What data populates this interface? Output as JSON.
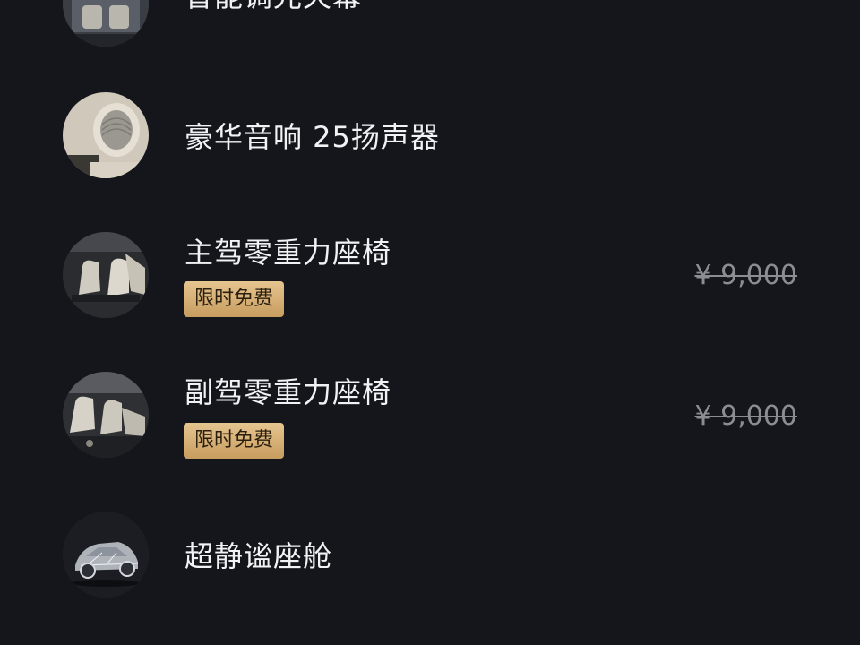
{
  "features": [
    {
      "title": "智能调光天幕",
      "thumb_icon": "interior-cabin-icon"
    },
    {
      "title": "豪华音响 25扬声器",
      "thumb_icon": "speaker-headrest-icon"
    },
    {
      "title": "主驾零重力座椅",
      "badge": "限时免费",
      "original_price": "¥ 9,000",
      "thumb_icon": "car-seat-icon"
    },
    {
      "title": "副驾零重力座椅",
      "badge": "限时免费",
      "original_price": "¥ 9,000",
      "thumb_icon": "car-seat-icon"
    },
    {
      "title": "超静谧座舱",
      "thumb_icon": "car-xray-icon"
    }
  ],
  "colors": {
    "background": "#14161c",
    "title_text": "#f2f2f4",
    "badge_gold": "#d9b67a",
    "price_strikethrough": "#8b8d93"
  }
}
